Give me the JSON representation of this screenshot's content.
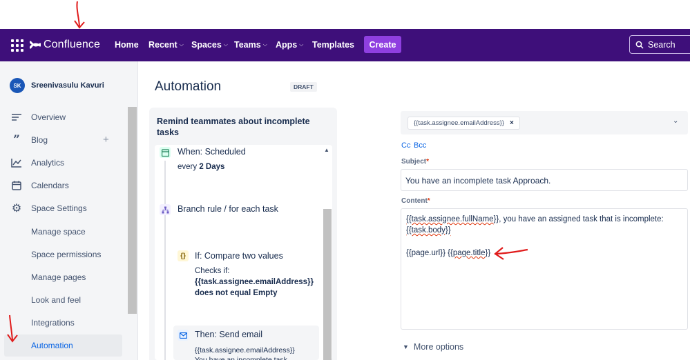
{
  "nav": {
    "brand": "Confluence",
    "items": [
      {
        "label": "Home",
        "dropdown": false
      },
      {
        "label": "Recent",
        "dropdown": true
      },
      {
        "label": "Spaces",
        "dropdown": true
      },
      {
        "label": "Teams",
        "dropdown": true
      },
      {
        "label": "Apps",
        "dropdown": true
      },
      {
        "label": "Templates",
        "dropdown": false
      }
    ],
    "create_label": "Create",
    "search_label": "Search",
    "colors": {
      "bar": "#3e0f7a",
      "create": "#8f3fe0"
    }
  },
  "sidebar": {
    "avatar_initials": "SK",
    "space_name": "Sreenivasulu Kavuri",
    "items": [
      {
        "label": "Overview",
        "icon": "overview-icon"
      },
      {
        "label": "Blog",
        "icon": "quote-icon"
      },
      {
        "label": "Analytics",
        "icon": "chart-line-icon"
      },
      {
        "label": "Calendars",
        "icon": "calendar-icon"
      },
      {
        "label": "Space Settings",
        "icon": "gear-icon"
      }
    ],
    "sub_items": [
      "Manage space",
      "Space permissions",
      "Manage pages",
      "Look and feel",
      "Integrations"
    ],
    "active_item": "Automation"
  },
  "main": {
    "title": "Automation",
    "badge": "DRAFT"
  },
  "rule": {
    "title": "Remind teammates about incomplete tasks",
    "trigger_title": "When: Scheduled",
    "trigger_sub_prefix": "every ",
    "trigger_sub_value": "2 Days",
    "branch_title": "Branch rule / for each task",
    "condition_title": "If: Compare two values",
    "condition_checks": "Checks if:",
    "condition_field": "{{task.assignee.emailAddress}}",
    "condition_op": "does not equal Empty",
    "action_title": "Then: Send email",
    "action_line1": "{{task.assignee.emailAddress}}",
    "action_line2": "You have an incomplete task"
  },
  "email_form": {
    "to_chip": "{{task.assignee.emailAddress}}",
    "cc_label": "Cc",
    "bcc_label": "Bcc",
    "subject_label": "Subject",
    "subject_value": "You have an incomplete task Approach.",
    "content_label": "Content",
    "content_line1_a": "{{task.assignee.fullName",
    "content_line1_b": "}}, you have an assigned task that is incomplete:",
    "content_line2": "{{task.body}}",
    "content_line3_a": "{{page.url}} {{",
    "content_line3_b": "page.title",
    "content_line3_c": "}}",
    "more_options": "More options"
  }
}
